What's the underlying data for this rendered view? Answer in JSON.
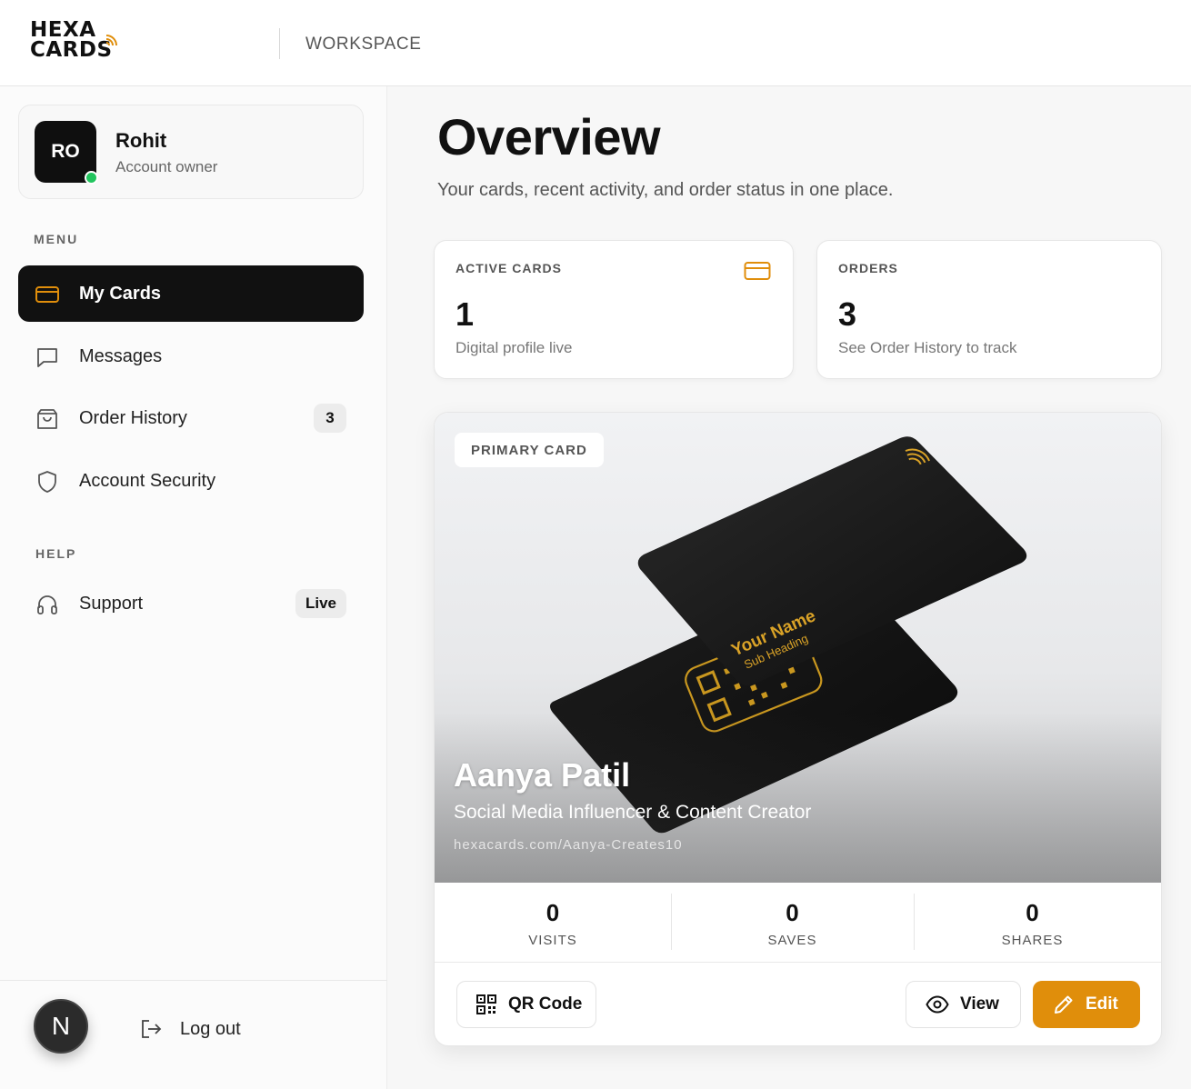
{
  "header": {
    "logo_line1": "HEXA",
    "logo_line2": "CARDS",
    "section": "WORKSPACE"
  },
  "profile": {
    "initials": "RO",
    "name": "Rohit",
    "role": "Account owner",
    "status": "online"
  },
  "sidebar": {
    "menu_label": "MENU",
    "items": [
      {
        "label": "My Cards",
        "icon": "card-icon",
        "active": true
      },
      {
        "label": "Messages",
        "icon": "message-icon"
      },
      {
        "label": "Order History",
        "icon": "shopping-bag-icon",
        "badge": "3"
      },
      {
        "label": "Account Security",
        "icon": "shield-icon"
      }
    ],
    "help_label": "HELP",
    "help_items": [
      {
        "label": "Support",
        "icon": "headphones-icon",
        "badge": "Live"
      }
    ],
    "footer": {
      "user_initial": "N",
      "logout_label": "Log out"
    }
  },
  "main": {
    "title": "Overview",
    "subtitle": "Your cards, recent activity, and order status in one place.",
    "stats": [
      {
        "label": "ACTIVE CARDS",
        "value": "1",
        "description": "Digital profile live",
        "icon": "card-icon"
      },
      {
        "label": "ORDERS",
        "value": "3",
        "description": "See Order History to track"
      }
    ],
    "primary_card": {
      "tag": "PRIMARY CARD",
      "card_print_name": "Your Name",
      "card_print_sub": "Sub Heading",
      "name": "Aanya Patil",
      "title": "Social Media Influencer & Content Creator",
      "url": "hexacards.com/Aanya-Creates10",
      "metrics": [
        {
          "value": "0",
          "label": "VISITS"
        },
        {
          "value": "0",
          "label": "SAVES"
        },
        {
          "value": "0",
          "label": "SHARES"
        }
      ],
      "actions": {
        "qr": "QR Code",
        "view": "View",
        "edit": "Edit"
      }
    }
  },
  "colors": {
    "accent": "#e08e0b",
    "dark": "#111111",
    "online": "#22c55e",
    "gold": "#d9a227"
  }
}
